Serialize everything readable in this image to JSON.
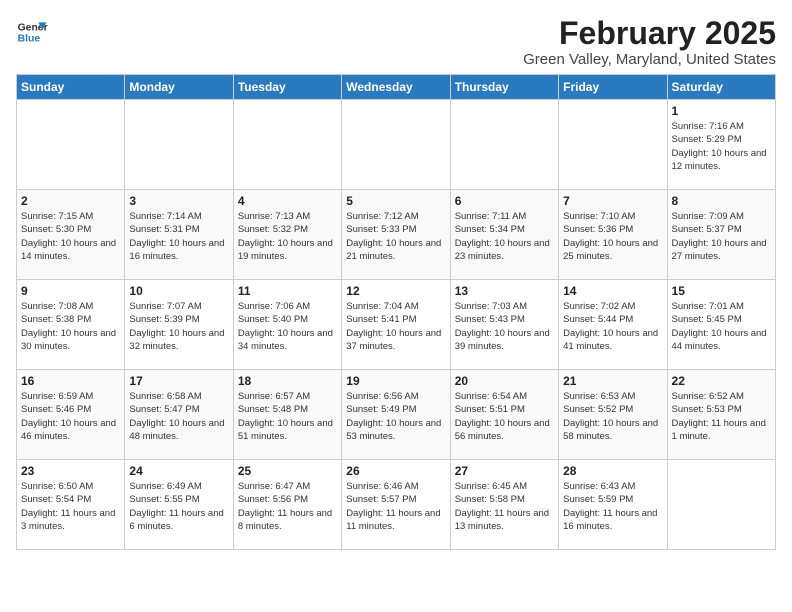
{
  "header": {
    "logo_line1": "General",
    "logo_line2": "Blue",
    "title": "February 2025",
    "subtitle": "Green Valley, Maryland, United States"
  },
  "weekdays": [
    "Sunday",
    "Monday",
    "Tuesday",
    "Wednesday",
    "Thursday",
    "Friday",
    "Saturday"
  ],
  "weeks": [
    [
      {
        "day": "",
        "info": ""
      },
      {
        "day": "",
        "info": ""
      },
      {
        "day": "",
        "info": ""
      },
      {
        "day": "",
        "info": ""
      },
      {
        "day": "",
        "info": ""
      },
      {
        "day": "",
        "info": ""
      },
      {
        "day": "1",
        "info": "Sunrise: 7:16 AM\nSunset: 5:29 PM\nDaylight: 10 hours and 12 minutes."
      }
    ],
    [
      {
        "day": "2",
        "info": "Sunrise: 7:15 AM\nSunset: 5:30 PM\nDaylight: 10 hours and 14 minutes."
      },
      {
        "day": "3",
        "info": "Sunrise: 7:14 AM\nSunset: 5:31 PM\nDaylight: 10 hours and 16 minutes."
      },
      {
        "day": "4",
        "info": "Sunrise: 7:13 AM\nSunset: 5:32 PM\nDaylight: 10 hours and 19 minutes."
      },
      {
        "day": "5",
        "info": "Sunrise: 7:12 AM\nSunset: 5:33 PM\nDaylight: 10 hours and 21 minutes."
      },
      {
        "day": "6",
        "info": "Sunrise: 7:11 AM\nSunset: 5:34 PM\nDaylight: 10 hours and 23 minutes."
      },
      {
        "day": "7",
        "info": "Sunrise: 7:10 AM\nSunset: 5:36 PM\nDaylight: 10 hours and 25 minutes."
      },
      {
        "day": "8",
        "info": "Sunrise: 7:09 AM\nSunset: 5:37 PM\nDaylight: 10 hours and 27 minutes."
      }
    ],
    [
      {
        "day": "9",
        "info": "Sunrise: 7:08 AM\nSunset: 5:38 PM\nDaylight: 10 hours and 30 minutes."
      },
      {
        "day": "10",
        "info": "Sunrise: 7:07 AM\nSunset: 5:39 PM\nDaylight: 10 hours and 32 minutes."
      },
      {
        "day": "11",
        "info": "Sunrise: 7:06 AM\nSunset: 5:40 PM\nDaylight: 10 hours and 34 minutes."
      },
      {
        "day": "12",
        "info": "Sunrise: 7:04 AM\nSunset: 5:41 PM\nDaylight: 10 hours and 37 minutes."
      },
      {
        "day": "13",
        "info": "Sunrise: 7:03 AM\nSunset: 5:43 PM\nDaylight: 10 hours and 39 minutes."
      },
      {
        "day": "14",
        "info": "Sunrise: 7:02 AM\nSunset: 5:44 PM\nDaylight: 10 hours and 41 minutes."
      },
      {
        "day": "15",
        "info": "Sunrise: 7:01 AM\nSunset: 5:45 PM\nDaylight: 10 hours and 44 minutes."
      }
    ],
    [
      {
        "day": "16",
        "info": "Sunrise: 6:59 AM\nSunset: 5:46 PM\nDaylight: 10 hours and 46 minutes."
      },
      {
        "day": "17",
        "info": "Sunrise: 6:58 AM\nSunset: 5:47 PM\nDaylight: 10 hours and 48 minutes."
      },
      {
        "day": "18",
        "info": "Sunrise: 6:57 AM\nSunset: 5:48 PM\nDaylight: 10 hours and 51 minutes."
      },
      {
        "day": "19",
        "info": "Sunrise: 6:56 AM\nSunset: 5:49 PM\nDaylight: 10 hours and 53 minutes."
      },
      {
        "day": "20",
        "info": "Sunrise: 6:54 AM\nSunset: 5:51 PM\nDaylight: 10 hours and 56 minutes."
      },
      {
        "day": "21",
        "info": "Sunrise: 6:53 AM\nSunset: 5:52 PM\nDaylight: 10 hours and 58 minutes."
      },
      {
        "day": "22",
        "info": "Sunrise: 6:52 AM\nSunset: 5:53 PM\nDaylight: 11 hours and 1 minute."
      }
    ],
    [
      {
        "day": "23",
        "info": "Sunrise: 6:50 AM\nSunset: 5:54 PM\nDaylight: 11 hours and 3 minutes."
      },
      {
        "day": "24",
        "info": "Sunrise: 6:49 AM\nSunset: 5:55 PM\nDaylight: 11 hours and 6 minutes."
      },
      {
        "day": "25",
        "info": "Sunrise: 6:47 AM\nSunset: 5:56 PM\nDaylight: 11 hours and 8 minutes."
      },
      {
        "day": "26",
        "info": "Sunrise: 6:46 AM\nSunset: 5:57 PM\nDaylight: 11 hours and 11 minutes."
      },
      {
        "day": "27",
        "info": "Sunrise: 6:45 AM\nSunset: 5:58 PM\nDaylight: 11 hours and 13 minutes."
      },
      {
        "day": "28",
        "info": "Sunrise: 6:43 AM\nSunset: 5:59 PM\nDaylight: 11 hours and 16 minutes."
      },
      {
        "day": "",
        "info": ""
      }
    ]
  ]
}
